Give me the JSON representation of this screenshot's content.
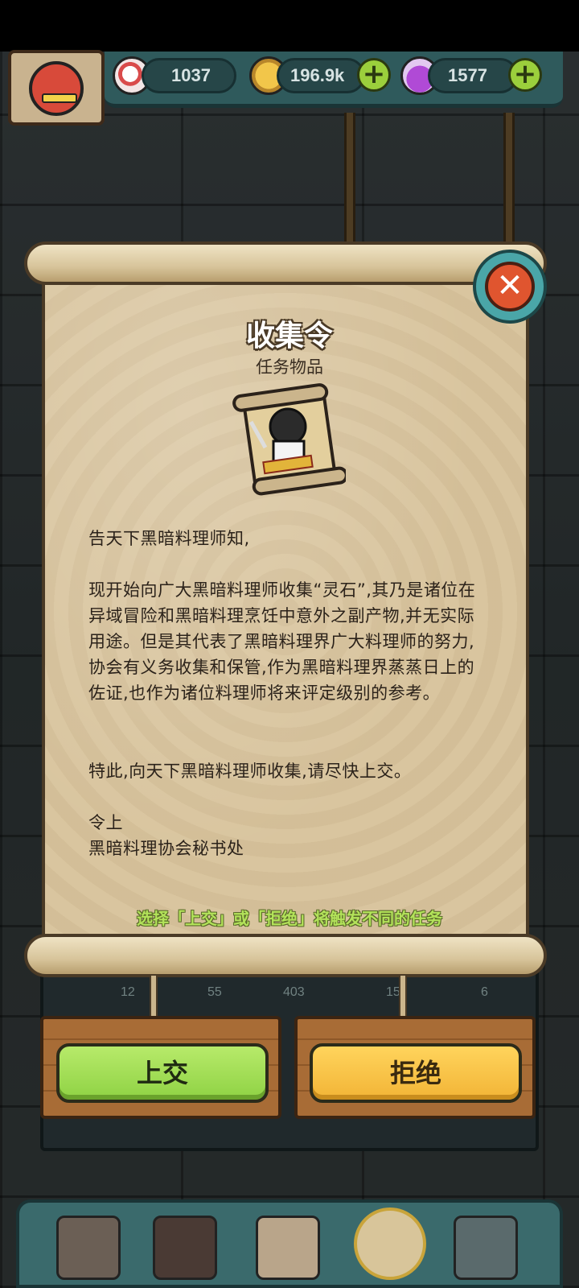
{
  "resources": {
    "eyeball_count": "1037",
    "coins": "196.9k",
    "potion": "1577",
    "plus_symbol": "+"
  },
  "modal": {
    "title": "收集令",
    "subtitle": "任务物品",
    "close_symbol": "✕",
    "letter": {
      "greeting": "告天下黑暗料理师知,",
      "paragraph1": "现开始向广大黑暗料理师收集“灵石”,其乃是诸位在异域冒险和黑暗料理烹饪中意外之副产物,并无实际用途。但是其代表了黑暗料理界广大料理师的努力,协会有义务收集和保管,作为黑暗料理界蒸蒸日上的佐证,也作为诸位料理师将来评定级别的参考。",
      "paragraph2": "特此,向天下黑暗料理师收集,请尽快上交。",
      "signoff": "令上",
      "signature": "黑暗料理协会秘书处"
    },
    "hint": "选择「上交」或「拒绝」将触发不同的任务"
  },
  "actions": {
    "accept_label": "上交",
    "reject_label": "拒绝"
  },
  "background_shelf": [
    "12",
    "55",
    "403",
    "15",
    "6"
  ],
  "colors": {
    "accept": "#8fd244",
    "reject": "#f2b436",
    "paper": "#d9c59f",
    "hint": "#b3e35a",
    "close": "#e0552f"
  }
}
